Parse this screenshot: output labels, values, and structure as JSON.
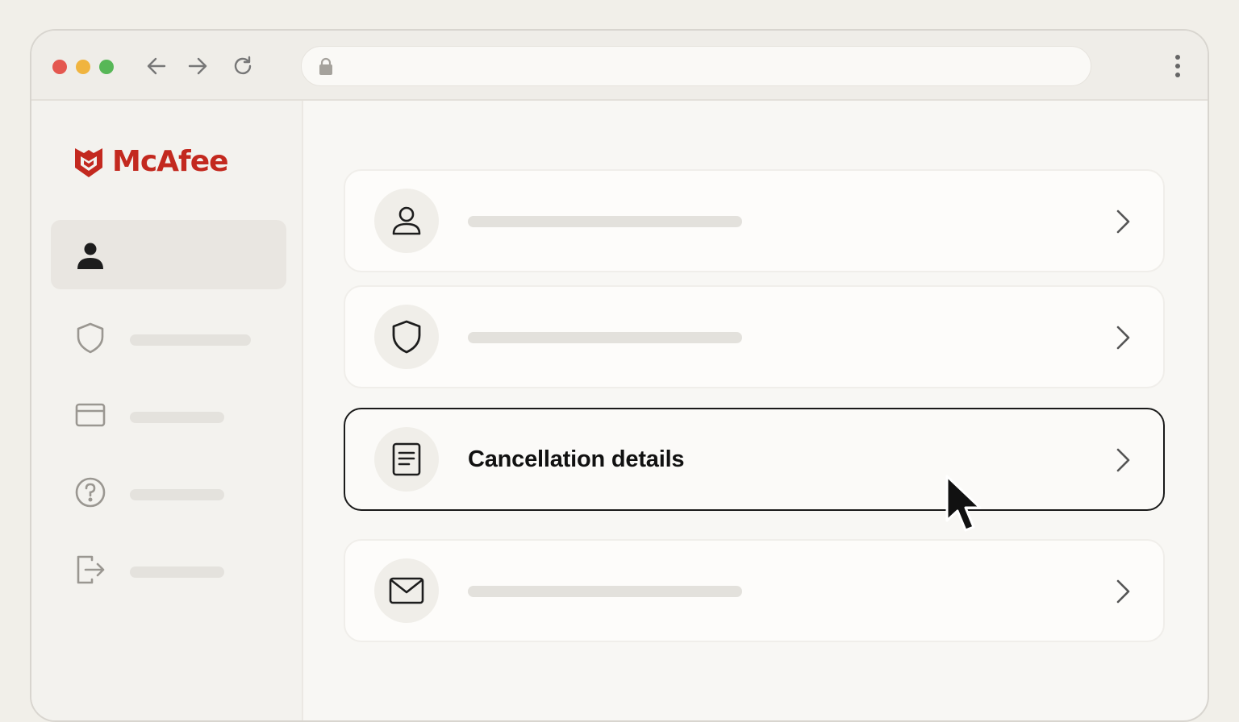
{
  "browser": {
    "url": "",
    "icons": {
      "back": "arrow-left-icon",
      "forward": "arrow-right-icon",
      "reload": "reload-icon",
      "lock": "lock-icon",
      "menu": "more-vertical-icon"
    },
    "window_controls": [
      "#e4574f",
      "#f0b43f",
      "#57b757"
    ]
  },
  "brand": {
    "name": "McAfee",
    "color": "#c3291f"
  },
  "sidebar": {
    "items": [
      {
        "icon": "user-icon",
        "label": "",
        "active": true
      },
      {
        "icon": "shield-icon",
        "label": "",
        "active": false
      },
      {
        "icon": "credit-card-icon",
        "label": "",
        "active": false
      },
      {
        "icon": "help-circle-icon",
        "label": "",
        "active": false
      },
      {
        "icon": "logout-icon",
        "label": "",
        "active": false
      }
    ]
  },
  "main": {
    "cards": [
      {
        "icon": "user-icon",
        "title": "",
        "selected": false
      },
      {
        "icon": "shield-icon",
        "title": "",
        "selected": false
      },
      {
        "icon": "document-icon",
        "title": "Cancellation details",
        "selected": true
      },
      {
        "icon": "mail-icon",
        "title": "",
        "selected": false
      }
    ]
  }
}
